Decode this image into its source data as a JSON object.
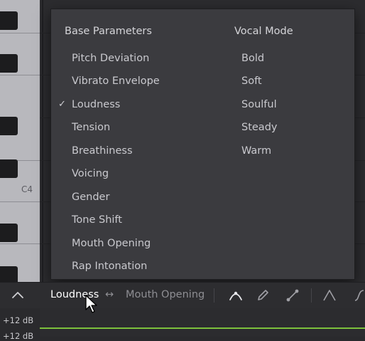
{
  "piano": {
    "c4_label": "C4"
  },
  "menu": {
    "left_header": "Base Parameters",
    "right_header": "Vocal Mode",
    "base_parameters": [
      {
        "label": "Pitch Deviation",
        "checked": false
      },
      {
        "label": "Vibrato Envelope",
        "checked": false
      },
      {
        "label": "Loudness",
        "checked": true
      },
      {
        "label": "Tension",
        "checked": false
      },
      {
        "label": "Breathiness",
        "checked": false
      },
      {
        "label": "Voicing",
        "checked": false
      },
      {
        "label": "Gender",
        "checked": false
      },
      {
        "label": "Tone Shift",
        "checked": false
      },
      {
        "label": "Mouth Opening",
        "checked": false
      },
      {
        "label": "Rap Intonation",
        "checked": false
      }
    ],
    "vocal_modes": [
      "Bold",
      "Soft",
      "Soulful",
      "Steady",
      "Warm"
    ],
    "check_glyph": "✓"
  },
  "toolbar": {
    "primary_param": "Loudness",
    "swap_glyph": "↔",
    "secondary_param": "Mouth Opening",
    "icons": [
      "collapse-chevron-icon",
      "curve-select-icon",
      "pencil-icon",
      "line-tool-icon",
      "peak-tool-icon",
      "s-curve-icon"
    ]
  },
  "lane": {
    "db_top": "+12 dB",
    "db_second": "+12 dB"
  },
  "colors": {
    "menu_bg": "#3b3b3f",
    "curve": "#7cc13c",
    "primary_text": "#ffffff",
    "secondary_text": "#8e8e93"
  }
}
